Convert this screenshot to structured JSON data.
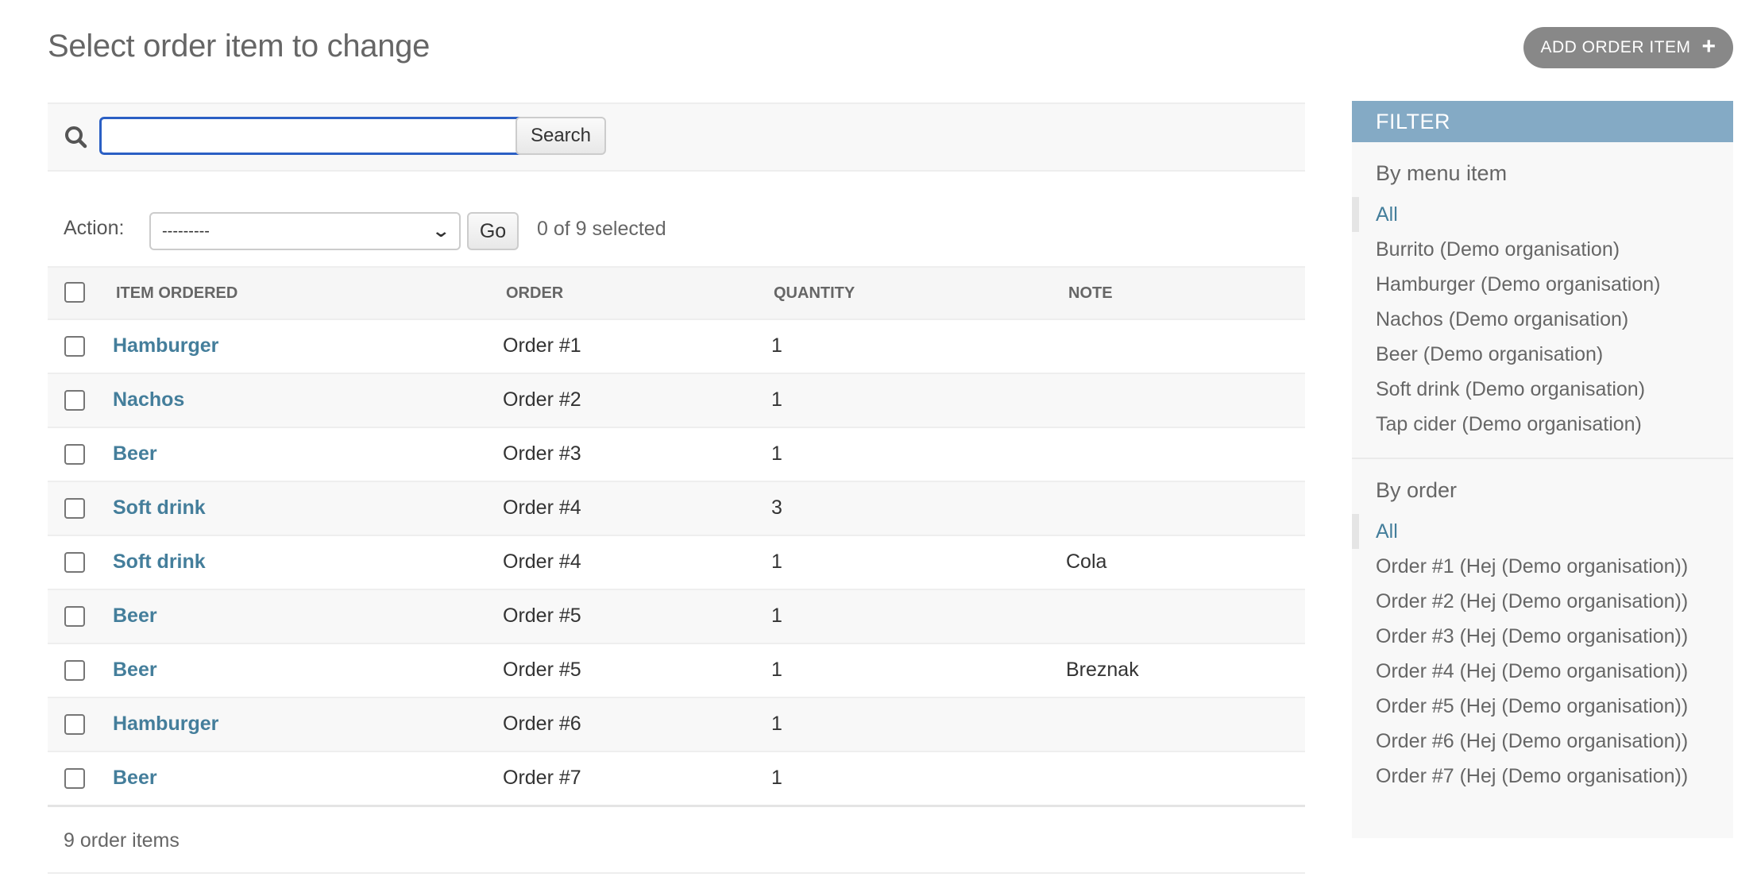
{
  "page": {
    "title": "Select order item to change",
    "add_button": {
      "label": "ADD ORDER ITEM",
      "icon": "plus-icon"
    }
  },
  "search": {
    "icon": "search-icon",
    "value": "",
    "placeholder": "",
    "button_label": "Search"
  },
  "actions": {
    "label": "Action:",
    "selected_option": "---------",
    "go_label": "Go",
    "selected_count": "0 of 9 selected"
  },
  "table": {
    "columns": [
      "Item ordered",
      "Order",
      "Quantity",
      "Note"
    ],
    "rows": [
      {
        "item": "Hamburger",
        "order": "Order #1",
        "quantity": "1",
        "note": ""
      },
      {
        "item": "Nachos",
        "order": "Order #2",
        "quantity": "1",
        "note": ""
      },
      {
        "item": "Beer",
        "order": "Order #3",
        "quantity": "1",
        "note": ""
      },
      {
        "item": "Soft drink",
        "order": "Order #4",
        "quantity": "3",
        "note": ""
      },
      {
        "item": "Soft drink",
        "order": "Order #4",
        "quantity": "1",
        "note": "Cola"
      },
      {
        "item": "Beer",
        "order": "Order #5",
        "quantity": "1",
        "note": ""
      },
      {
        "item": "Beer",
        "order": "Order #5",
        "quantity": "1",
        "note": "Breznak"
      },
      {
        "item": "Hamburger",
        "order": "Order #6",
        "quantity": "1",
        "note": ""
      },
      {
        "item": "Beer",
        "order": "Order #7",
        "quantity": "1",
        "note": ""
      }
    ]
  },
  "paginator": {
    "text": "9 order items"
  },
  "filter": {
    "title": "FILTER",
    "groups": [
      {
        "title": "By menu item",
        "items": [
          {
            "label": "All",
            "selected": true
          },
          {
            "label": "Burrito (Demo organisation)",
            "selected": false
          },
          {
            "label": "Hamburger (Demo organisation)",
            "selected": false
          },
          {
            "label": "Nachos (Demo organisation)",
            "selected": false
          },
          {
            "label": "Beer (Demo organisation)",
            "selected": false
          },
          {
            "label": "Soft drink (Demo organisation)",
            "selected": false
          },
          {
            "label": "Tap cider (Demo organisation)",
            "selected": false
          }
        ]
      },
      {
        "title": "By order",
        "items": [
          {
            "label": "All",
            "selected": true
          },
          {
            "label": "Order #1 (Hej (Demo organisation))",
            "selected": false
          },
          {
            "label": "Order #2 (Hej (Demo organisation))",
            "selected": false
          },
          {
            "label": "Order #3 (Hej (Demo organisation))",
            "selected": false
          },
          {
            "label": "Order #4 (Hej (Demo organisation))",
            "selected": false
          },
          {
            "label": "Order #5 (Hej (Demo organisation))",
            "selected": false
          },
          {
            "label": "Order #6 (Hej (Demo organisation))",
            "selected": false
          },
          {
            "label": "Order #7 (Hej (Demo organisation))",
            "selected": false
          }
        ]
      }
    ]
  },
  "colors": {
    "link": "#447e9b",
    "filter_header": "#84aac5",
    "add_button": "#888888",
    "search_focus": "#2b5fc4"
  }
}
